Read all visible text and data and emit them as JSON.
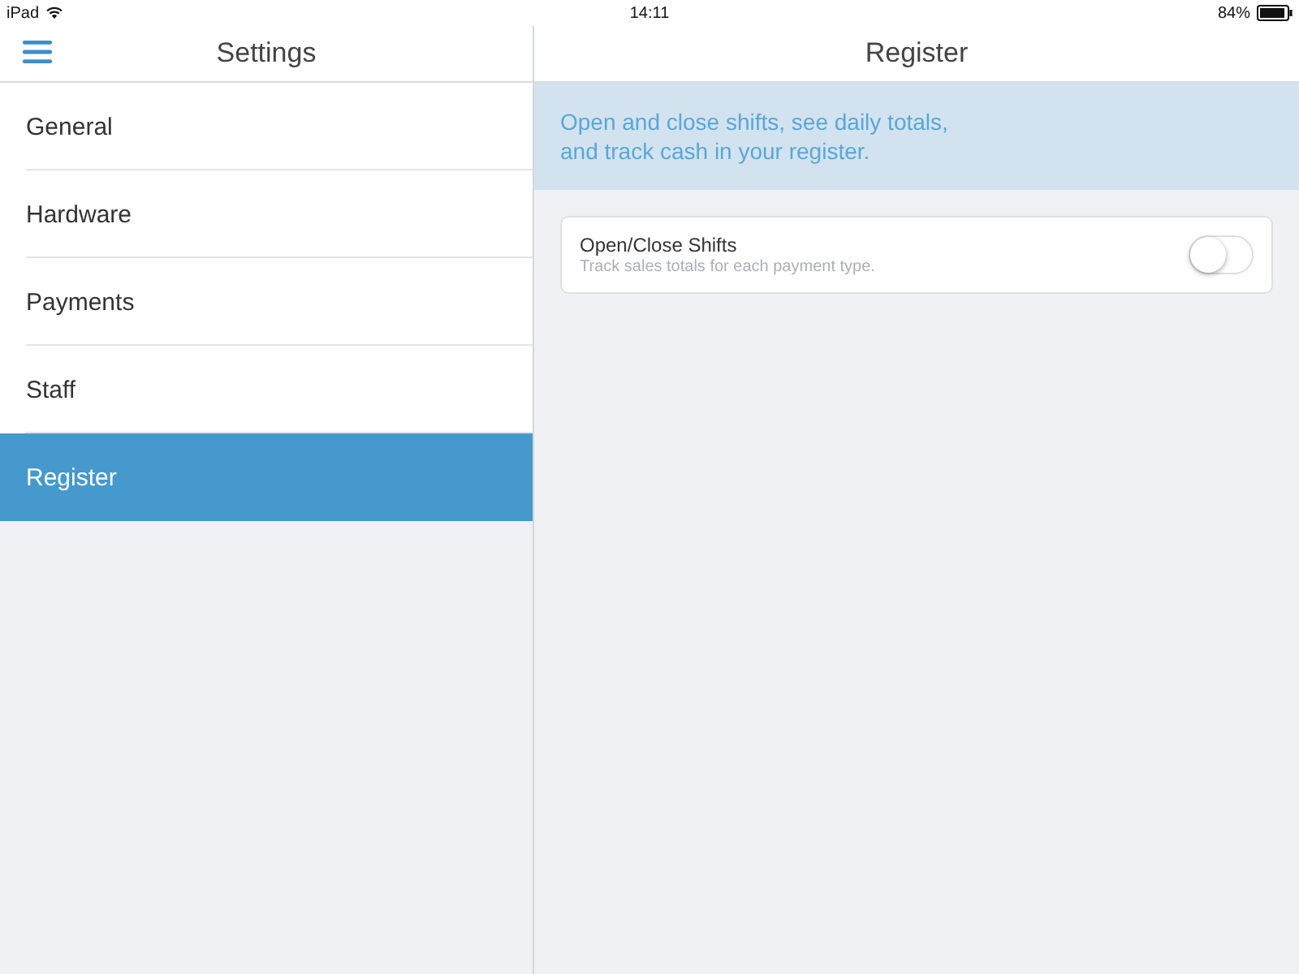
{
  "status_bar": {
    "device": "iPad",
    "time": "14:11",
    "battery": "84%"
  },
  "sidebar": {
    "title": "Settings",
    "items": [
      {
        "label": "General",
        "selected": false
      },
      {
        "label": "Hardware",
        "selected": false
      },
      {
        "label": "Payments",
        "selected": false
      },
      {
        "label": "Staff",
        "selected": false
      },
      {
        "label": "Register",
        "selected": true
      }
    ]
  },
  "detail": {
    "title": "Register",
    "banner": "Open and close shifts, see daily totals,\nand track cash in your register.",
    "settings": [
      {
        "title": "Open/Close Shifts",
        "description": "Track sales totals for each payment type.",
        "on": false
      }
    ]
  }
}
